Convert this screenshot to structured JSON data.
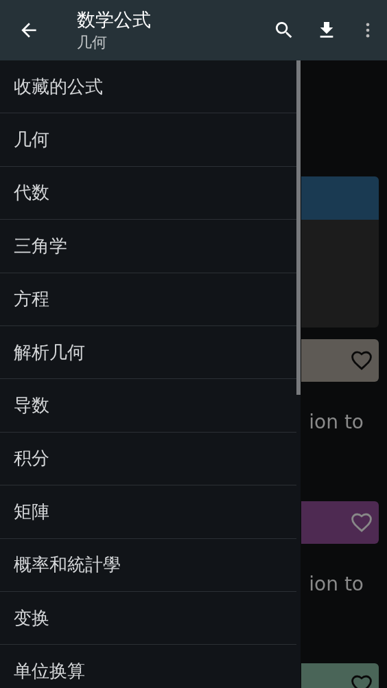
{
  "app_bar": {
    "title": "数学公式",
    "subtitle": "几何"
  },
  "drawer": {
    "items": [
      {
        "label": "收藏的公式"
      },
      {
        "label": "几何"
      },
      {
        "label": "代数"
      },
      {
        "label": "三角学"
      },
      {
        "label": "方程"
      },
      {
        "label": "解析几何"
      },
      {
        "label": "导数"
      },
      {
        "label": "积分"
      },
      {
        "label": "矩陣"
      },
      {
        "label": "概率和統計學"
      },
      {
        "label": "变换"
      },
      {
        "label": "单位换算"
      }
    ]
  },
  "content": {
    "cards": [
      {
        "kind": "large",
        "color": "#1a3a52"
      },
      {
        "kind": "strip",
        "color": "#5e5a55",
        "caption": "ion to"
      },
      {
        "kind": "strip",
        "color": "#4e2a52",
        "caption": "ion to"
      },
      {
        "kind": "strip",
        "color": "#4a6558"
      }
    ]
  }
}
